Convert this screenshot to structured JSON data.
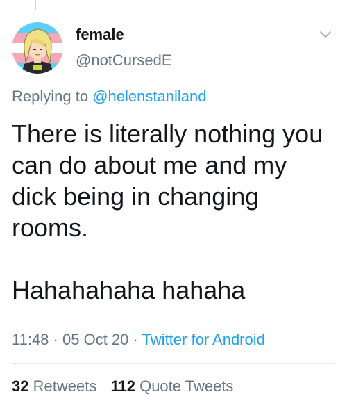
{
  "tweet": {
    "display_name": "female",
    "handle": "@notCursedE",
    "avatar": "avatar-cartoon-trans-flag",
    "menu_icon": "chevron-down-icon",
    "reply": {
      "prefix": "Replying to",
      "mention": "@helenstaniland"
    },
    "text": "There is literally nothing you can do about me and my dick being in changing rooms.\n\nHahahahaha hahaha",
    "time": "11:48",
    "date": "05 Oct 20",
    "source": "Twitter for Android",
    "separator": "·"
  },
  "stats": {
    "retweets_count": "32",
    "retweets_label": "Retweets",
    "quotes_count": "112",
    "quotes_label": "Quote Tweets"
  },
  "colors": {
    "text": "#14171a",
    "secondary": "#657786",
    "link": "#1da1f2",
    "divider": "#e6ecf0",
    "flag_blue": "#5bcefa",
    "flag_pink": "#f5a9b8",
    "flag_white": "#ffffff"
  }
}
